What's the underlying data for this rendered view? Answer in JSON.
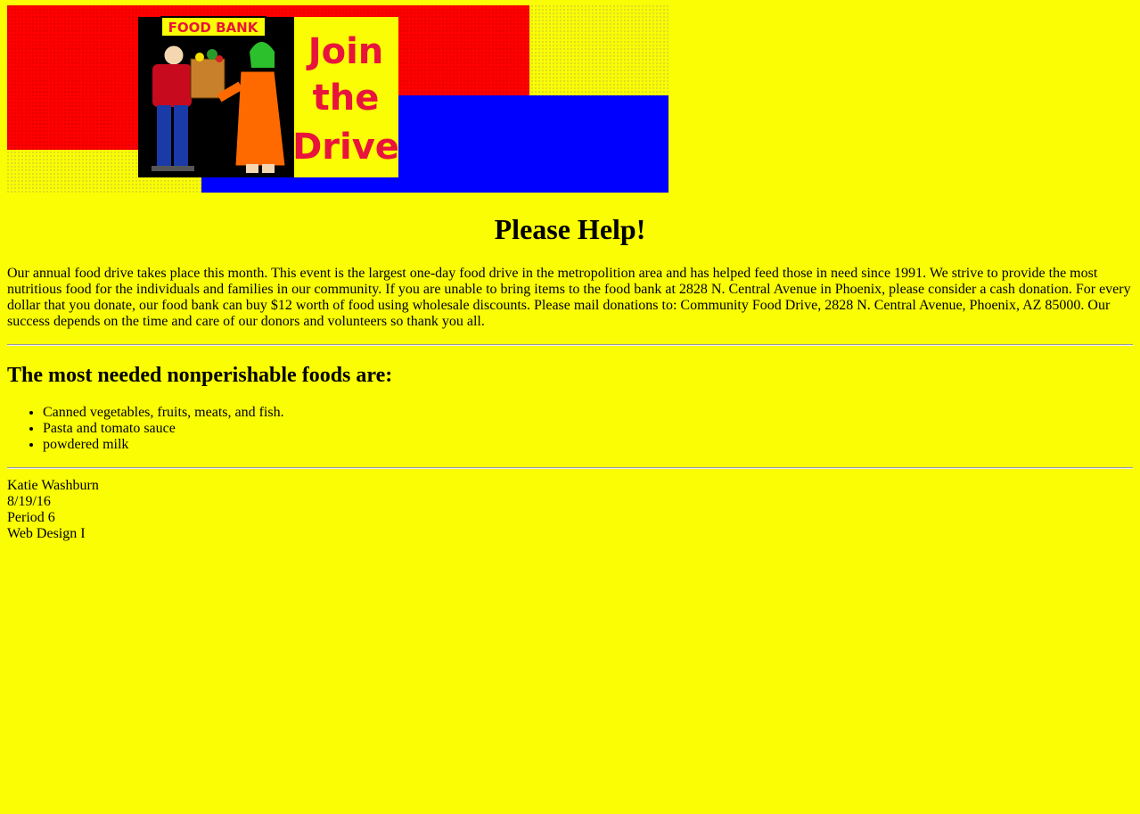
{
  "banner": {
    "sign_text": "FOOD BANK",
    "slogan_lines": [
      "Join",
      "the",
      "Drive"
    ],
    "colors": {
      "red": "#ff0000",
      "blue": "#0000ff",
      "yellow": "#fafd03",
      "slogan": "#e8143c",
      "black": "#000000"
    }
  },
  "heading": "Please Help!",
  "intro": "Our annual food drive takes place this month. This event is the largest one-day food drive in the metropolition area and has helped feed those in need since 1991. We strive to provide the most nutritious food for the individuals and families in our community. If you are unable to bring items to the food bank at 2828 N. Central Avenue in Phoenix, please consider a cash donation. For every dollar that you donate, our food bank can buy $12 worth of food using wholesale discounts. Please mail donations to: Community Food Drive, 2828 N. Central Avenue, Phoenix, AZ 85000. Our success depends on the time and care of our donors and volunteers so thank you all.",
  "subheading": "The most needed nonperishable foods are:",
  "foods": [
    "Canned vegetables, fruits, meats, and fish.",
    "Pasta and tomato sauce",
    "powdered milk"
  ],
  "signature": {
    "name": "Katie Washburn",
    "date": "8/19/16",
    "period": "Period 6",
    "course": "Web Design I"
  },
  "page_background": "#fafd03"
}
